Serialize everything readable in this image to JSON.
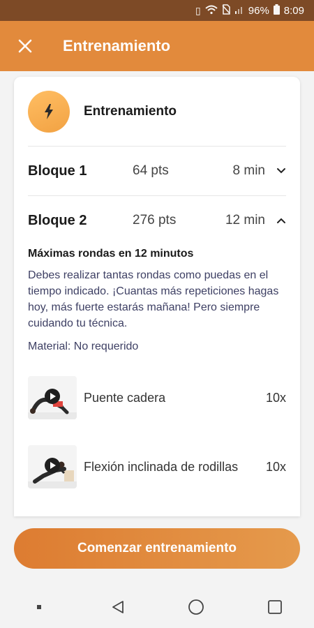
{
  "status_bar": {
    "battery": "96%",
    "time": "8:09"
  },
  "app_bar": {
    "title": "Entrenamiento",
    "close_icon": "close-icon"
  },
  "card": {
    "title": "Entrenamiento",
    "icon": "bolt-icon",
    "blocks": [
      {
        "name": "Bloque 1",
        "points": "64 pts",
        "duration": "8 min",
        "expanded": false
      },
      {
        "name": "Bloque 2",
        "points": "276 pts",
        "duration": "12 min",
        "expanded": true
      }
    ],
    "detail": {
      "title": "Máximas rondas en 12 minutos",
      "description": "Debes realizar tantas rondas como puedas en el tiempo indicado. ¡Cuantas más repeticiones hagas hoy, más fuerte estarás mañana! Pero siempre cuidando tu técnica.",
      "material": "Material: No requerido"
    },
    "exercises": [
      {
        "name": "Puente cadera",
        "reps": "10x"
      },
      {
        "name": "Flexión inclinada de rodillas",
        "reps": "10x"
      }
    ]
  },
  "start_button": {
    "label": "Comenzar entrenamiento"
  },
  "colors": {
    "accent": "#e28a3c",
    "status_bar": "#7d4a26",
    "text_blue": "#3e4064"
  }
}
